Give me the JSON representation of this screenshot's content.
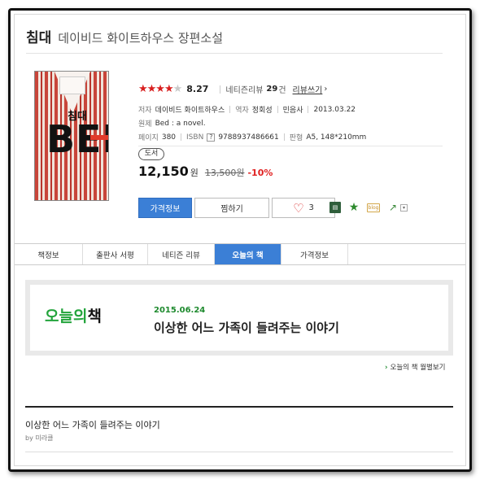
{
  "book": {
    "title": "침대",
    "subtitle": "데이비드 화이트하우스 장편소설"
  },
  "cover": {
    "hangul_title": "침대",
    "english_title": "BED"
  },
  "rating": {
    "stars_filled": 4,
    "stars_total": 5,
    "score": "8.27",
    "reviews_label": "네티즌리뷰",
    "reviews_count": "29",
    "reviews_unit": "건",
    "write_review_label": "리뷰쓰기"
  },
  "info": {
    "author_key": "저자",
    "author": "데이비드 화이트하우스",
    "translator_key": "역자",
    "translator": "정회성",
    "publisher": "민음사",
    "pub_date": "2013.03.22",
    "original_key": "원제",
    "original_title": "Bed : a novel.",
    "pages_key": "페이지",
    "pages": "380",
    "isbn_key": "ISBN",
    "isbn_help": "?",
    "isbn": "9788937486661",
    "format_key": "판형",
    "format": "A5, 148*210mm"
  },
  "price": {
    "badge": "도서",
    "current": "12,150",
    "current_unit": "원",
    "original": "13,500원",
    "discount": "-10%"
  },
  "buttons": {
    "price_info": "가격정보",
    "wishlist": "찜하기",
    "like_count": "3"
  },
  "tools": {
    "tool1_icon": "bookmark-card-icon",
    "tool2_icon": "star-icon",
    "tool3_icon": "blog-icon",
    "tool3_text": "blog",
    "tool4_icon": "share-icon",
    "tool5_icon": "caret-down-icon"
  },
  "tabs": [
    {
      "label": "책정보"
    },
    {
      "label": "출판사 서평"
    },
    {
      "label": "네티즌 리뷰"
    },
    {
      "label": "오늘의 책"
    },
    {
      "label": "가격정보"
    }
  ],
  "today_book": {
    "logo_green": "오늘의",
    "logo_black": "책",
    "date": "2015.06.24",
    "headline": "이상한 어느 가족이 들려주는 이야기",
    "monthly_link": "오늘의 책 월별보기"
  },
  "article": {
    "title": "이상한 어느 가족이 들려주는 이야기",
    "by": "by 미라클"
  },
  "colors": {
    "accent_blue": "#3b7fd6",
    "star_red": "#d81f1f",
    "discount_red": "#e02020",
    "today_green": "#23a43c"
  }
}
